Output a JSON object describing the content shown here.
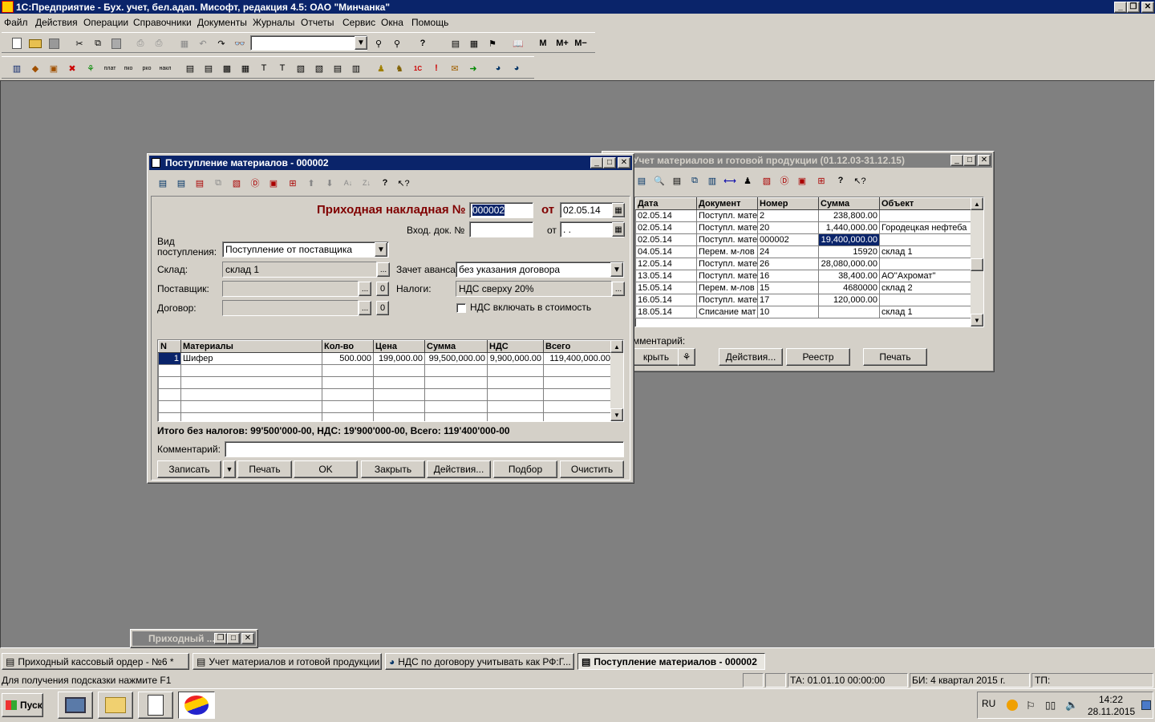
{
  "app": {
    "title": "1С:Предприятие - Бух. учет, бел.адап. Мисофт, редакция 4.5: ОАО \"Минчанка\""
  },
  "menu": [
    "Файл",
    "Действия",
    "Операции",
    "Справочники",
    "Документы",
    "Журналы",
    "Отчеты",
    "Сервис",
    "Окна",
    "Помощь"
  ],
  "toolbar": {
    "m_label": "М",
    "mplus_label": "М+",
    "mminus_label": "М−"
  },
  "journal": {
    "title": "Учет материалов и готовой продукции (01.12.03-31.12.15)",
    "columns": [
      "Дата",
      "Документ",
      "Номер",
      "Сумма",
      "Объект"
    ],
    "rows": [
      [
        "02.05.14",
        "Поступл. мате",
        "2",
        "238,800.00",
        ""
      ],
      [
        "02.05.14",
        "Поступл. мате",
        "20",
        "1,440,000.00",
        "Городецкая нефтеба"
      ],
      [
        "02.05.14",
        "Поступл. мате",
        "000002",
        "19,400,000.00",
        ""
      ],
      [
        "04.05.14",
        "Перем. м-лов",
        "24",
        "15920",
        "склад 1"
      ],
      [
        "12.05.14",
        "Поступл. мате",
        "26",
        "28,080,000.00",
        ""
      ],
      [
        "13.05.14",
        "Поступл. мате",
        "16",
        "38,400.00",
        "АО''Ахромат''"
      ],
      [
        "15.05.14",
        "Перем. м-лов",
        "15",
        "4680000",
        "склад 2"
      ],
      [
        "16.05.14",
        "Поступл. мате",
        "17",
        "120,000.00",
        ""
      ],
      [
        "18.05.14",
        "Списание мат",
        "10",
        "",
        "склад 1"
      ]
    ],
    "comment_label": "мментарий:",
    "btn_close": "крыть",
    "btn_actions": "Действия...",
    "btn_registry": "Реестр",
    "btn_print": "Печать"
  },
  "doc": {
    "title": "Поступление материалов - 000002",
    "heading": "Приходная накладная №",
    "number": "000002",
    "from_label": "от",
    "date": "02.05.14",
    "in_doc_label": "Вход. док. №",
    "in_doc_value": "",
    "from2_label": "от",
    "date2": " .  .",
    "vid_label": "Вид\nпоступления:",
    "vid_value": "Поступление от поставщика",
    "sklad_label": "Склад:",
    "sklad_value": "склад 1",
    "postavshik_label": "Поставщик:",
    "postavshik_value": "",
    "dogovor_label": "Договор:",
    "dogovor_value": "",
    "zachet_label": "Зачет аванса:",
    "zachet_value": "без указания договора",
    "nalogi_label": "Налоги:",
    "nalogi_value": "НДС сверху 20%",
    "nds_checkbox_label": "НДС включать в стоимость",
    "zero_label": "0",
    "dots_label": "...",
    "table_columns": [
      "N",
      "Материалы",
      "Кол-во",
      "Цена",
      "Сумма",
      "НДС",
      "Всего"
    ],
    "table_rows": [
      [
        "1",
        "Шифер",
        "500.000",
        "199,000.00",
        "99,500,000.00",
        "9,900,000.00",
        "119,400,000.00"
      ]
    ],
    "totals": "Итого без налогов: 99'500'000-00, НДС: 19'900'000-00, Всего: 119'400'000-00",
    "comment_label": "Комментарий:",
    "comment_value": "",
    "buttons": {
      "save": "Записать",
      "print": "Печать",
      "ok": "OK",
      "close": "Закрыть",
      "actions": "Действия...",
      "select": "Подбор",
      "clear": "Очистить"
    }
  },
  "minimized": {
    "title": "Приходный ..."
  },
  "taskbar_windows": [
    "Приходный кассовый ордер - №6 *",
    "Учет материалов и готовой продукции ...",
    "НДС по договору учитывать как РФ:Г...",
    "Поступление материалов - 000002"
  ],
  "status": {
    "hint": "Для получения подсказки нажмите F1",
    "ta": "ТА: 01.01.10  00:00:00",
    "bi": "БИ: 4 квартал 2015 г.",
    "tp": "ТП:"
  },
  "start_label": "Пуск",
  "tray": {
    "lang": "RU",
    "time": "14:22",
    "date": "28.11.2015"
  },
  "colors": {
    "title_active": "#0a246a",
    "mdi_bg": "#808080",
    "heading_red": "#800000"
  }
}
